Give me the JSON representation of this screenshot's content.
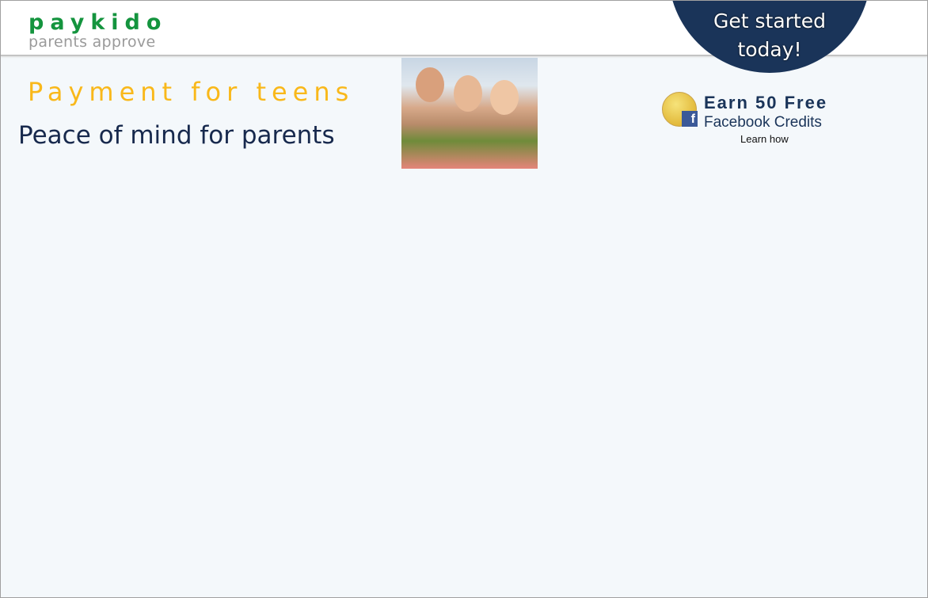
{
  "header": {
    "logo": "paykido",
    "tagline": "parents approve",
    "cta_line1": "Get started",
    "cta_line2": "today!"
  },
  "hero": {
    "title": "Payment for teens",
    "subtitle": "Peace of mind for parents"
  },
  "promo": {
    "line1": "Earn 50 Free",
    "line2": "Facebook Credits",
    "link": "Learn how",
    "fb_glyph": "f"
  },
  "colors": {
    "brand_green": "#14943e",
    "accent_yellow": "#f9b81a",
    "navy": "#1a3459"
  }
}
